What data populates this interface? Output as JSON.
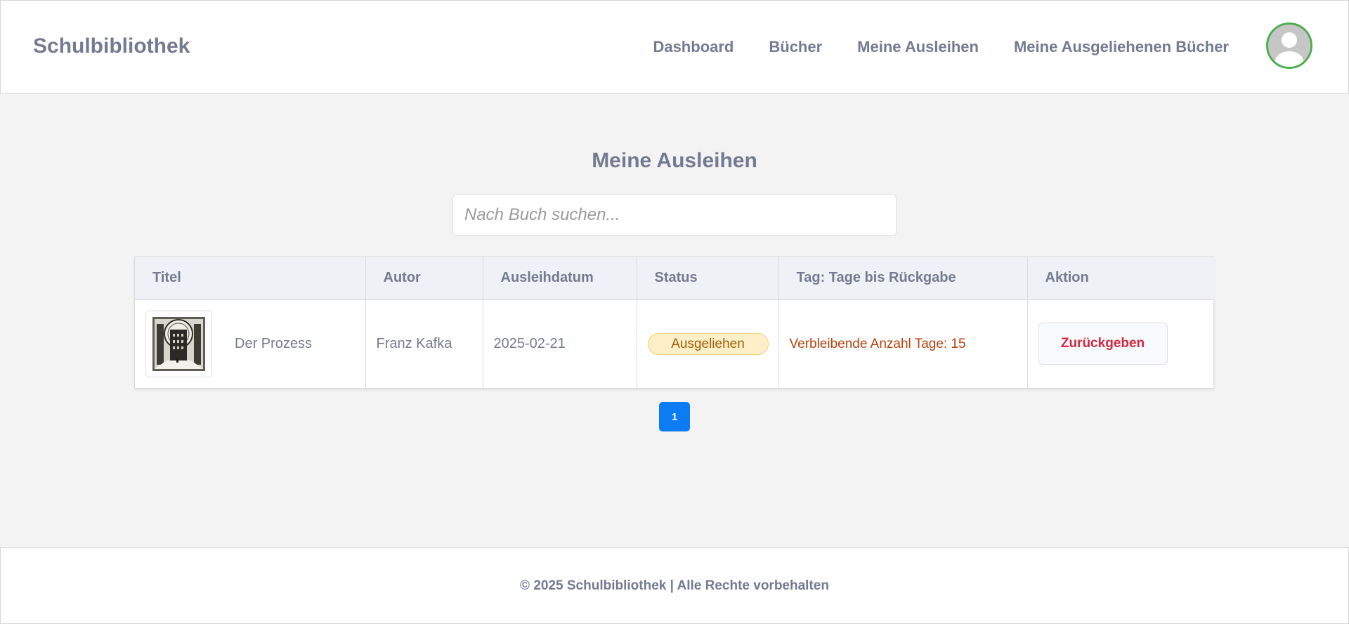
{
  "header": {
    "brand": "Schulbibliothek",
    "nav": [
      "Dashboard",
      "Bücher",
      "Meine Ausleihen",
      "Meine Ausgeliehenen Bücher"
    ],
    "avatar_icon": "user-avatar-icon"
  },
  "main": {
    "title": "Meine Ausleihen",
    "search_placeholder": "Nach Buch suchen...",
    "table": {
      "headers": [
        "Titel",
        "Autor",
        "Ausleihdatum",
        "Status",
        "Tag: Tage bis Rückgabe",
        "Aktion"
      ],
      "rows": [
        {
          "title": "Der Prozess",
          "author": "Franz Kafka",
          "date": "2025-02-21",
          "status": "Ausgeliehen",
          "remaining": "Verbleibende Anzahl Tage: 15",
          "action": "Zurückgeben"
        }
      ]
    },
    "pagination": {
      "current": "1"
    }
  },
  "footer": {
    "text": "© 2025 Schulbibliothek | Alle Rechte vorbehalten"
  },
  "colors": {
    "text": "#737b91",
    "accent": "#0b7cf3",
    "status_bg": "#fdefc7",
    "danger": "#d7263d",
    "avatar_border": "#4caf50"
  }
}
